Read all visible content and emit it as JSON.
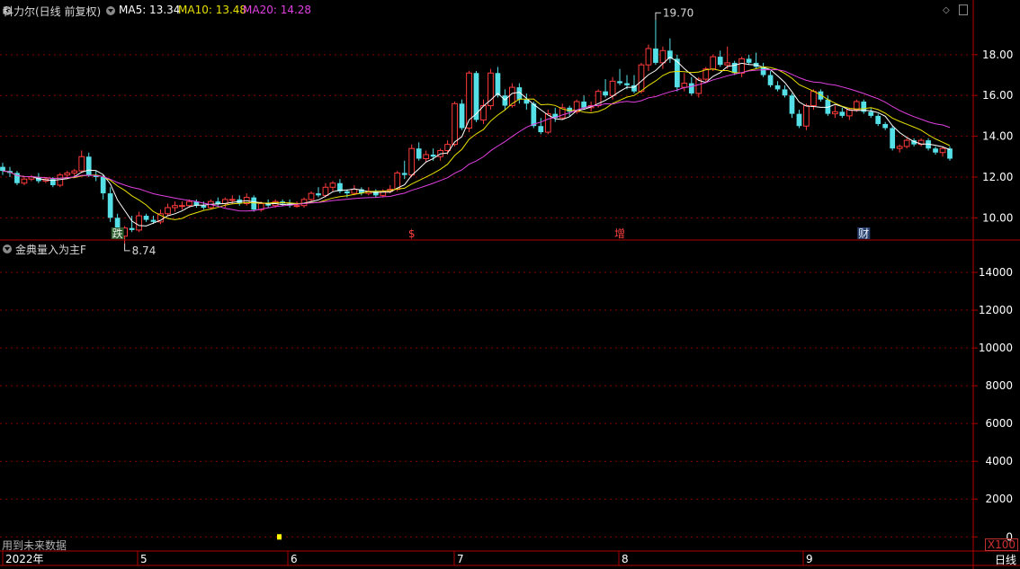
{
  "header": {
    "stock_title": "科力尔(日线 前复权)",
    "ma5_label": "MA5: 13.34",
    "ma10_label": "MA10: 13.48",
    "ma20_label": "MA20: 14.28"
  },
  "indicator": {
    "title": "金典量入为主F",
    "future_note": "用到未来数据",
    "multiplier": "X100"
  },
  "period_button": "日线",
  "colors": {
    "up": "#ff3b3b",
    "down": "#54e0e6",
    "ma5": "#ffffff",
    "ma10": "#e8e000",
    "ma20": "#e040e0",
    "grid": "#8a0000",
    "frame": "#b00000",
    "axis_text": "#ffffff",
    "marker": "#ffff00"
  },
  "chart_data": [
    {
      "type": "candlestick",
      "title": "科力尔(日线 前复权)",
      "ylim": [
        9.0,
        19.8
      ],
      "y_ticks": [
        "10.00",
        "12.00",
        "14.00",
        "16.00",
        "18.00"
      ],
      "annotations": {
        "high": "19.70",
        "low": "8.74"
      },
      "event_markers": [
        "跌",
        "$",
        "增",
        "财"
      ],
      "x_labels": [
        "2022年",
        "5",
        "6",
        "7",
        "8",
        "9"
      ],
      "bars": [
        [
          12.5,
          12.7,
          12.1,
          12.3
        ],
        [
          12.3,
          12.5,
          12.0,
          12.2
        ],
        [
          12.2,
          12.3,
          11.6,
          11.7
        ],
        [
          11.7,
          12.0,
          11.6,
          11.9
        ],
        [
          11.9,
          12.1,
          11.8,
          12.0
        ],
        [
          12.0,
          12.2,
          11.7,
          11.8
        ],
        [
          11.8,
          12.0,
          11.7,
          11.9
        ],
        [
          11.9,
          12.0,
          11.5,
          11.6
        ],
        [
          11.6,
          12.2,
          11.5,
          12.1
        ],
        [
          12.1,
          12.3,
          11.9,
          12.2
        ],
        [
          12.2,
          12.4,
          12.0,
          12.3
        ],
        [
          12.3,
          13.3,
          12.2,
          13.0
        ],
        [
          13.0,
          13.2,
          12.0,
          12.1
        ],
        [
          12.1,
          12.3,
          11.8,
          12.0
        ],
        [
          12.0,
          12.1,
          10.9,
          11.2
        ],
        [
          11.2,
          11.5,
          9.8,
          10.0
        ],
        [
          10.0,
          10.2,
          9.0,
          9.1
        ],
        [
          9.1,
          9.6,
          8.74,
          9.5
        ],
        [
          9.5,
          10.1,
          9.3,
          9.4
        ],
        [
          9.4,
          10.3,
          9.3,
          10.1
        ],
        [
          10.1,
          10.2,
          9.8,
          9.9
        ],
        [
          9.9,
          10.1,
          9.7,
          9.8
        ],
        [
          9.8,
          10.4,
          9.7,
          10.2
        ],
        [
          10.2,
          10.7,
          10.1,
          10.5
        ],
        [
          10.5,
          10.8,
          10.3,
          10.6
        ],
        [
          10.6,
          10.8,
          10.4,
          10.6
        ],
        [
          10.6,
          10.9,
          10.5,
          10.8
        ],
        [
          10.8,
          10.9,
          10.5,
          10.6
        ],
        [
          10.6,
          10.8,
          10.4,
          10.5
        ],
        [
          10.5,
          10.9,
          10.4,
          10.8
        ],
        [
          10.8,
          11.0,
          10.6,
          10.7
        ],
        [
          10.7,
          11.0,
          10.5,
          10.9
        ],
        [
          10.9,
          11.1,
          10.7,
          10.9
        ],
        [
          10.9,
          11.1,
          10.6,
          10.7
        ],
        [
          10.7,
          11.2,
          10.6,
          11.0
        ],
        [
          11.0,
          11.1,
          10.3,
          10.4
        ],
        [
          10.4,
          10.8,
          10.3,
          10.7
        ],
        [
          10.7,
          10.9,
          10.5,
          10.6
        ],
        [
          10.6,
          10.9,
          10.5,
          10.8
        ],
        [
          10.8,
          10.9,
          10.6,
          10.7
        ],
        [
          10.7,
          10.9,
          10.5,
          10.6
        ],
        [
          10.6,
          10.8,
          10.5,
          10.6
        ],
        [
          10.6,
          11.0,
          10.5,
          10.9
        ],
        [
          10.9,
          11.3,
          10.8,
          11.2
        ],
        [
          11.2,
          11.5,
          11.0,
          11.1
        ],
        [
          11.1,
          11.7,
          11.0,
          11.5
        ],
        [
          11.5,
          11.8,
          11.3,
          11.7
        ],
        [
          11.7,
          11.9,
          11.2,
          11.3
        ],
        [
          11.3,
          11.4,
          11.0,
          11.2
        ],
        [
          11.2,
          11.6,
          11.1,
          11.4
        ],
        [
          11.4,
          11.5,
          11.1,
          11.2
        ],
        [
          11.2,
          11.5,
          11.1,
          11.3
        ],
        [
          11.3,
          11.4,
          11.0,
          11.1
        ],
        [
          11.1,
          11.4,
          11.0,
          11.3
        ],
        [
          11.3,
          11.6,
          11.2,
          11.4
        ],
        [
          11.4,
          12.3,
          11.3,
          12.2
        ],
        [
          12.2,
          12.8,
          11.9,
          12.1
        ],
        [
          12.1,
          13.6,
          12.0,
          13.4
        ],
        [
          13.4,
          13.7,
          12.8,
          12.9
        ],
        [
          12.9,
          13.3,
          12.7,
          13.1
        ],
        [
          13.1,
          13.4,
          12.8,
          13.0
        ],
        [
          13.0,
          13.4,
          12.8,
          13.3
        ],
        [
          13.3,
          13.8,
          13.1,
          13.6
        ],
        [
          13.6,
          15.7,
          13.5,
          15.6
        ],
        [
          15.6,
          15.8,
          14.3,
          14.4
        ],
        [
          14.4,
          17.2,
          14.2,
          17.1
        ],
        [
          17.1,
          17.2,
          14.7,
          14.8
        ],
        [
          14.8,
          15.8,
          14.6,
          15.5
        ],
        [
          15.5,
          17.3,
          15.3,
          17.1
        ],
        [
          17.1,
          17.4,
          15.9,
          16.0
        ],
        [
          16.0,
          16.3,
          15.3,
          15.5
        ],
        [
          15.5,
          16.6,
          15.4,
          16.4
        ],
        [
          16.4,
          16.6,
          15.6,
          15.8
        ],
        [
          15.8,
          16.1,
          15.3,
          15.6
        ],
        [
          15.6,
          15.7,
          14.4,
          14.5
        ],
        [
          14.5,
          14.9,
          14.1,
          14.2
        ],
        [
          14.2,
          15.3,
          14.1,
          15.1
        ],
        [
          15.1,
          15.4,
          14.7,
          14.9
        ],
        [
          14.9,
          15.6,
          14.8,
          15.4
        ],
        [
          15.4,
          15.5,
          15.0,
          15.2
        ],
        [
          15.2,
          15.8,
          15.1,
          15.7
        ],
        [
          15.7,
          16.0,
          15.3,
          15.4
        ],
        [
          15.4,
          15.7,
          15.2,
          15.5
        ],
        [
          15.5,
          16.3,
          15.4,
          16.2
        ],
        [
          16.2,
          16.8,
          15.9,
          16.0
        ],
        [
          16.0,
          16.9,
          15.8,
          16.7
        ],
        [
          16.7,
          17.3,
          16.5,
          16.6
        ],
        [
          16.6,
          17.0,
          16.3,
          16.5
        ],
        [
          16.5,
          17.0,
          16.1,
          16.2
        ],
        [
          16.2,
          17.6,
          16.1,
          17.5
        ],
        [
          17.5,
          18.5,
          17.2,
          18.3
        ],
        [
          18.3,
          19.7,
          17.5,
          17.6
        ],
        [
          17.6,
          18.4,
          17.3,
          18.2
        ],
        [
          18.2,
          18.8,
          17.6,
          17.8
        ],
        [
          17.8,
          18.0,
          16.2,
          16.4
        ],
        [
          16.4,
          17.1,
          16.2,
          16.6
        ],
        [
          16.6,
          16.9,
          16.0,
          16.1
        ],
        [
          16.1,
          16.9,
          15.9,
          16.8
        ],
        [
          16.8,
          17.4,
          16.6,
          17.3
        ],
        [
          17.3,
          18.0,
          17.2,
          17.9
        ],
        [
          17.9,
          18.2,
          17.4,
          17.5
        ],
        [
          17.5,
          18.4,
          17.3,
          17.6
        ],
        [
          17.6,
          17.7,
          17.0,
          17.1
        ],
        [
          17.1,
          17.9,
          16.9,
          17.8
        ],
        [
          17.8,
          18.0,
          17.5,
          17.6
        ],
        [
          17.6,
          18.1,
          17.3,
          17.4
        ],
        [
          17.4,
          17.6,
          16.9,
          17.0
        ],
        [
          17.0,
          17.2,
          16.4,
          16.5
        ],
        [
          16.5,
          16.7,
          16.2,
          16.3
        ],
        [
          16.3,
          16.5,
          15.9,
          16.0
        ],
        [
          16.0,
          16.1,
          14.9,
          15.1
        ],
        [
          15.1,
          15.3,
          14.4,
          14.5
        ],
        [
          14.5,
          15.6,
          14.3,
          15.5
        ],
        [
          15.5,
          16.3,
          15.3,
          16.2
        ],
        [
          16.2,
          16.3,
          15.7,
          15.8
        ],
        [
          15.8,
          16.0,
          15.0,
          15.1
        ],
        [
          15.1,
          15.5,
          14.9,
          15.2
        ],
        [
          15.2,
          15.4,
          14.9,
          15.0
        ],
        [
          15.0,
          15.4,
          14.8,
          15.3
        ],
        [
          15.3,
          15.8,
          15.2,
          15.7
        ],
        [
          15.7,
          15.8,
          15.1,
          15.2
        ],
        [
          15.2,
          15.4,
          14.9,
          15.0
        ],
        [
          15.0,
          15.1,
          14.5,
          14.6
        ],
        [
          14.6,
          14.7,
          14.3,
          14.4
        ],
        [
          14.4,
          14.5,
          13.3,
          13.4
        ],
        [
          13.4,
          13.6,
          13.2,
          13.5
        ],
        [
          13.5,
          13.9,
          13.4,
          13.8
        ],
        [
          13.8,
          13.9,
          13.5,
          13.6
        ],
        [
          13.6,
          13.9,
          13.5,
          13.8
        ],
        [
          13.8,
          13.9,
          13.3,
          13.4
        ],
        [
          13.4,
          13.5,
          13.1,
          13.2
        ],
        [
          13.2,
          13.5,
          13.0,
          13.4
        ],
        [
          13.4,
          13.5,
          12.8,
          12.9
        ]
      ]
    },
    {
      "type": "bar",
      "title": "金典量入为主F",
      "ylim": [
        -700,
        15000
      ],
      "y_ticks": [
        "0",
        "2000",
        "4000",
        "6000",
        "8000",
        "10000",
        "12000",
        "14000"
      ],
      "series": [
        {
          "values": [
            0
          ]
        }
      ]
    }
  ]
}
